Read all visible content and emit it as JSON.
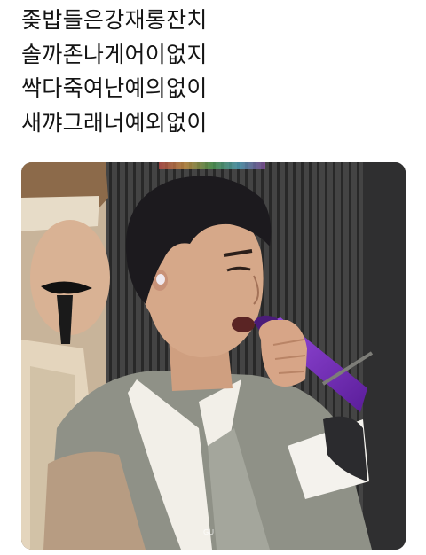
{
  "post": {
    "lines": [
      "좆밥들은강재롱잔치",
      "솔까존나게어이없지",
      "싹다죽여난예의없이",
      "새꺄그래너예외없이"
    ]
  },
  "media": {
    "watermark": "GU",
    "colors": {
      "background": "#3a3a3a",
      "hanbok_grey": "#8f9187",
      "microphone": "#7b2fbf",
      "hair": "#1c1a1e",
      "skin": "#d6a889"
    }
  }
}
